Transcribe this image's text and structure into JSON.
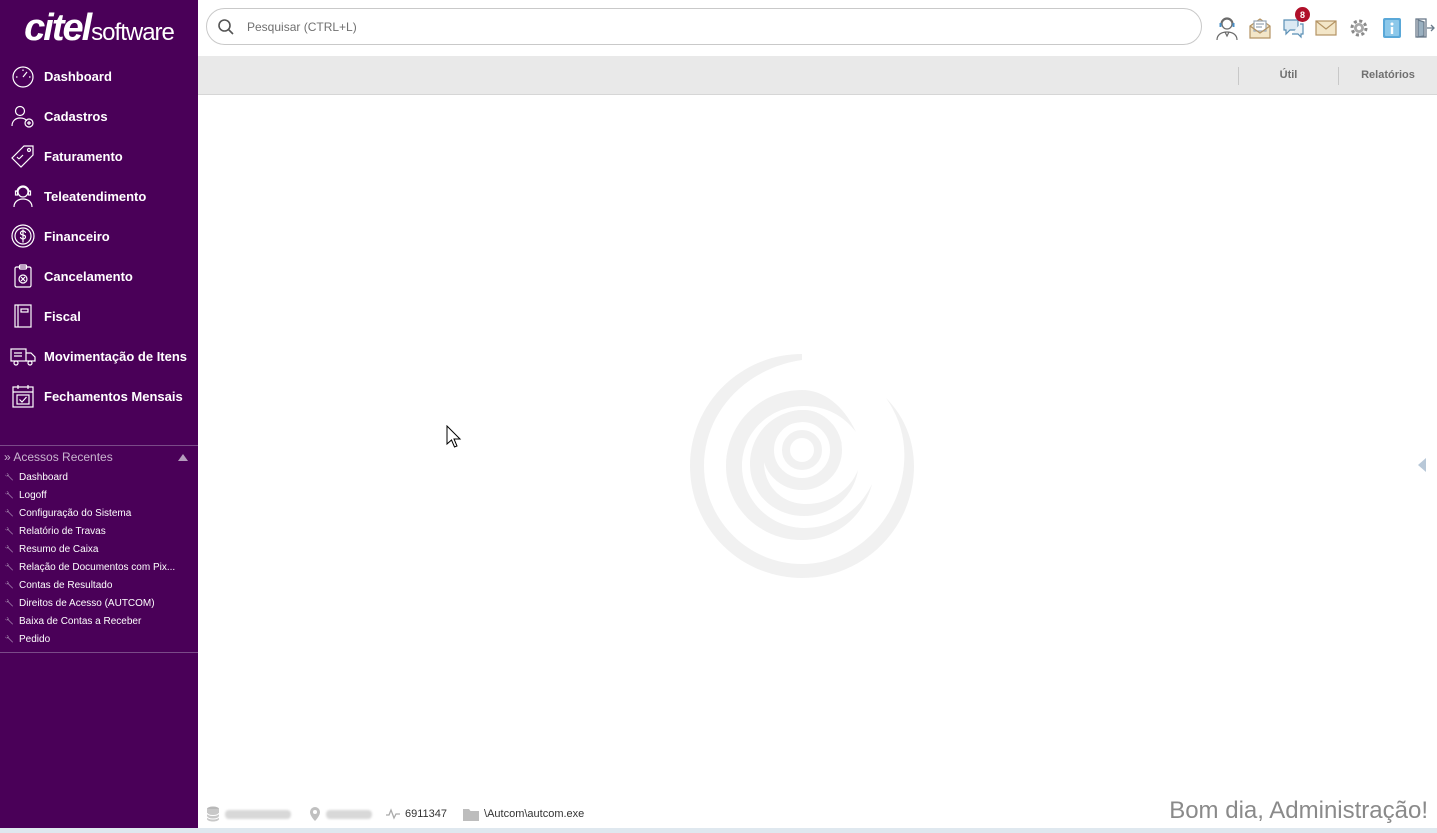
{
  "brand": {
    "logo_part1": "citel",
    "logo_part2": "software",
    "color": "#4a0058"
  },
  "sidebar": {
    "items": [
      {
        "label": "Dashboard",
        "icon": "gauge-icon"
      },
      {
        "label": "Cadastros",
        "icon": "user-add-icon"
      },
      {
        "label": "Faturamento",
        "icon": "price-tag-icon"
      },
      {
        "label": "Teleatendimento",
        "icon": "headset-user-icon"
      },
      {
        "label": "Financeiro",
        "icon": "dollar-coin-icon"
      },
      {
        "label": "Cancelamento",
        "icon": "clipboard-cancel-icon"
      },
      {
        "label": "Fiscal",
        "icon": "notebook-icon"
      },
      {
        "label": "Movimentação de Itens",
        "icon": "truck-icon"
      },
      {
        "label": "Fechamentos Mensais",
        "icon": "calendar-check-icon"
      }
    ],
    "recent": {
      "title": "» Acessos Recentes",
      "items": [
        "Dashboard",
        "Logoff",
        "Configuração do Sistema",
        "Relatório de Travas",
        "Resumo de Caixa",
        "Relação de Documentos com Pix...",
        "Contas de Resultado",
        "Direitos de Acesso (AUTCOM)",
        "Baixa de Contas a Receber",
        "Pedido"
      ]
    }
  },
  "search": {
    "placeholder": "Pesquisar (CTRL+L)",
    "value": ""
  },
  "toolbar": {
    "icons": [
      "support-agent-icon",
      "mail-open-icon",
      "chat-icon",
      "envelope-icon",
      "gear-icon",
      "info-icon",
      "exit-icon"
    ],
    "chat_badge": "8"
  },
  "subbar": {
    "tab_util": "Útil",
    "tab_relatorios": "Relatórios"
  },
  "status": {
    "session_id": "6911347",
    "path": "\\Autcom\\autcom.exe"
  },
  "greeting": "Bom dia, Administração!"
}
